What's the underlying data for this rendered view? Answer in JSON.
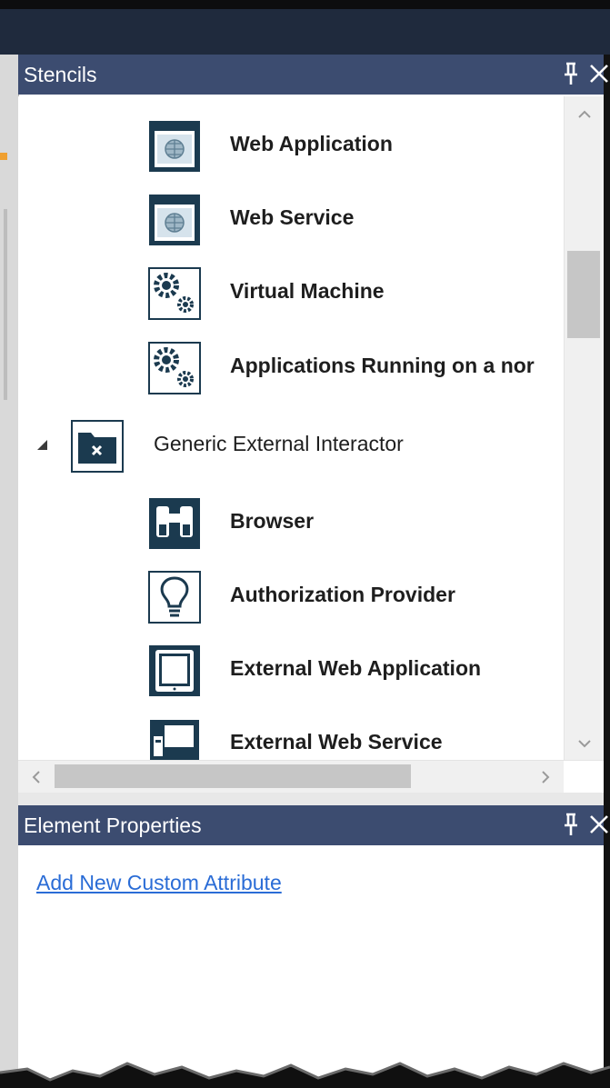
{
  "stencils_panel": {
    "title": "Stencils",
    "items": [
      {
        "label": "Web Application",
        "icon": "web-application-icon",
        "level": "child"
      },
      {
        "label": "Web Service",
        "icon": "web-service-icon",
        "level": "child"
      },
      {
        "label": "Virtual Machine",
        "icon": "gears-icon",
        "level": "child"
      },
      {
        "label": "Applications Running on a nor",
        "icon": "gears-icon",
        "level": "child"
      },
      {
        "label": "Generic External Interactor",
        "icon": "external-interactor-icon",
        "level": "parent",
        "expanded": true
      },
      {
        "label": "Browser",
        "icon": "binoculars-icon",
        "level": "child"
      },
      {
        "label": "Authorization Provider",
        "icon": "lightbulb-icon",
        "level": "child"
      },
      {
        "label": "External Web Application",
        "icon": "tablet-icon",
        "level": "child"
      },
      {
        "label": "External Web Service",
        "icon": "monitor-icon",
        "level": "child"
      }
    ]
  },
  "properties_panel": {
    "title": "Element Properties",
    "link_label": "Add New Custom Attribute"
  },
  "colors": {
    "header_bg": "#3c4c70",
    "icon_dark": "#1b3a4f",
    "link": "#2a6cd6"
  }
}
